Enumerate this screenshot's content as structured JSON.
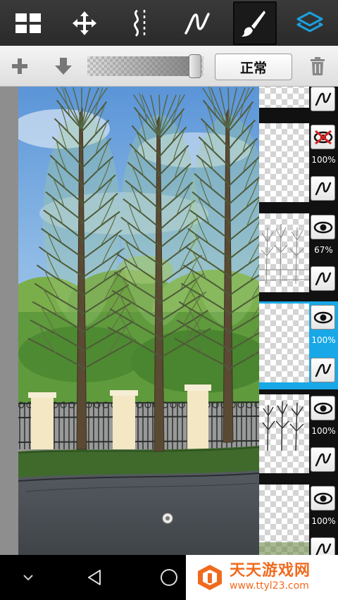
{
  "toolbar": {
    "tools": [
      {
        "id": "layers-grid",
        "icon": "grid-icon"
      },
      {
        "id": "move",
        "icon": "move-arrows-icon"
      },
      {
        "id": "symmetry",
        "icon": "symmetry-icon"
      },
      {
        "id": "stroke",
        "icon": "stroke-icon"
      },
      {
        "id": "brush",
        "icon": "brush-icon",
        "active": true
      },
      {
        "id": "layers",
        "icon": "layers-icon",
        "accent": "#1aa0e0"
      }
    ]
  },
  "layerbar": {
    "add_icon": "plus-icon",
    "merge_down_icon": "arrow-down-icon",
    "opacity_value": 0.98,
    "blend_mode": "正常",
    "delete_icon": "trash-icon"
  },
  "layers": [
    {
      "visible_icon": "brush-stroke-icon",
      "opacity": "",
      "thumb": "top-partial"
    },
    {
      "visible_icon": "hidden-eye-icon",
      "opacity": "100%",
      "thumb": "empty"
    },
    {
      "visible_icon": "eye-icon",
      "opacity": "67%",
      "thumb": "sketch"
    },
    {
      "visible_icon": "eye-icon",
      "opacity": "100%",
      "thumb": "empty",
      "selected": true
    },
    {
      "visible_icon": "eye-icon",
      "opacity": "100%",
      "thumb": "trees"
    },
    {
      "visible_icon": "eye-icon",
      "opacity": "100%",
      "thumb": "ground"
    }
  ],
  "navbar": {
    "icons": [
      "chevron-down-icon",
      "back-icon",
      "home-icon"
    ]
  },
  "watermark": {
    "title": "天天游戏网",
    "url": "www.ttyl23.com"
  },
  "colors": {
    "accent": "#18a8e8",
    "sky": "#6fa8e0",
    "grass": "#3f6a2c",
    "road": "#4a4f55"
  }
}
